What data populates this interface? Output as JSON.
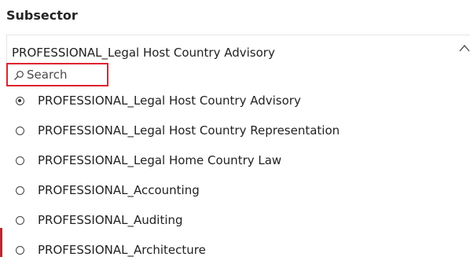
{
  "header": {
    "title": "Subsector"
  },
  "dropdown": {
    "selected_value": "PROFESSIONAL_Legal Host Country Advisory",
    "chevron_icon": "chevron-up-icon"
  },
  "search": {
    "placeholder": "Search",
    "value": "",
    "icon": "search-icon",
    "highlight_color": "#e0232f"
  },
  "options": [
    {
      "label": "PROFESSIONAL_Legal Host Country Advisory",
      "selected": true
    },
    {
      "label": "PROFESSIONAL_Legal Host Country Representation",
      "selected": false
    },
    {
      "label": "PROFESSIONAL_Legal Home Country Law",
      "selected": false
    },
    {
      "label": "PROFESSIONAL_Accounting",
      "selected": false
    },
    {
      "label": "PROFESSIONAL_Auditing",
      "selected": false
    },
    {
      "label": "PROFESSIONAL_Architecture",
      "selected": false
    }
  ],
  "accent_colors": {
    "left_marker": "#c0262d"
  }
}
